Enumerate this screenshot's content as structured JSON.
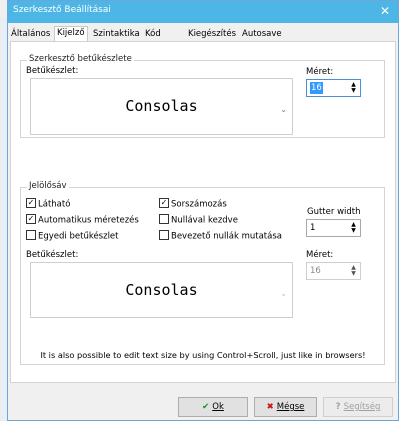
{
  "dialog": {
    "title": "Szerkesztő Beállításai",
    "close_glyph": "✕"
  },
  "tabs": [
    {
      "label": "Általános"
    },
    {
      "label": "Kijelző"
    },
    {
      "label": "Szintaktika"
    },
    {
      "label": "Kód"
    },
    {
      "label": "Kiegészítés"
    },
    {
      "label": "Autosave"
    }
  ],
  "active_tab": "Kijelző",
  "editor_font": {
    "group_title": "Szerkesztő betűkészlete",
    "font_label": "Betűkészlet:",
    "font_name": "Consolas",
    "size_label": "Méret:",
    "size_value": "16"
  },
  "line_numbers": {
    "group_title": "Jelölősáv",
    "checkboxes": [
      {
        "label": "Látható",
        "checked": true
      },
      {
        "label": "Automatikus méretezés",
        "checked": true
      },
      {
        "label": "Egyedi betűkészlet",
        "checked": false
      },
      {
        "label": "Sorszámozás",
        "checked": true
      },
      {
        "label": "Nullával kezdve",
        "checked": false
      },
      {
        "label": "Bevezető nullák mutatása",
        "checked": false
      }
    ],
    "gutter_label": "Gutter width",
    "gutter_value": "1",
    "font_label": "Betűkészlet:",
    "font_name": "Consolas",
    "size_label": "Méret:",
    "size_value": "16"
  },
  "hint": "It is also possible to edit text size by using Control+Scroll, just like in browsers!",
  "buttons": {
    "ok_label": "Ok",
    "cancel_label": "Mégse",
    "help_label": "Segítség"
  },
  "icons": {
    "ok": "check-icon",
    "cancel": "x-icon",
    "help": "question-icon",
    "close": "close-icon",
    "dropdown": "chevron-down-icon",
    "spin": "spin-arrows-icon"
  },
  "colors": {
    "titlebar": "#4eb6e6",
    "selection": "#3399ff",
    "ok_icon": "#1a8a1a",
    "cancel_icon": "#cc1111"
  }
}
